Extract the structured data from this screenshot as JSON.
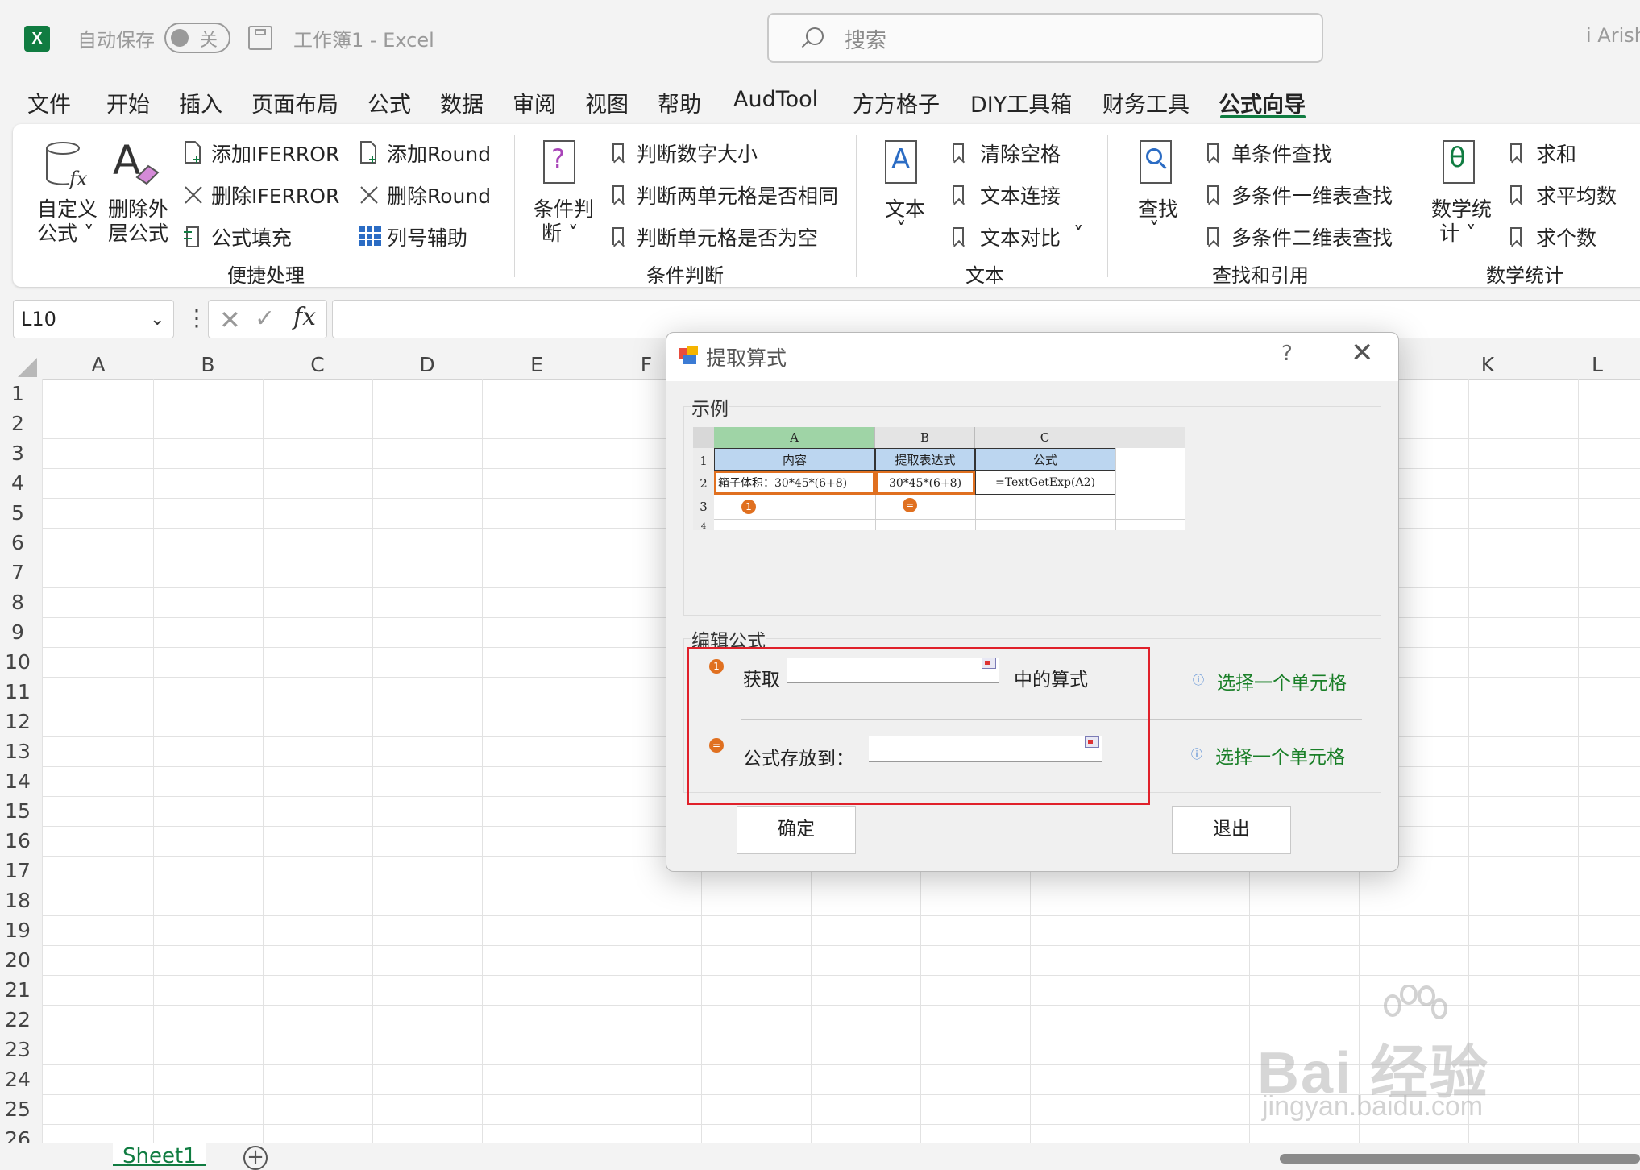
{
  "titlebar": {
    "app_icon_letter": "X",
    "autosave_label": "自动保存",
    "autosave_state": "关",
    "doc_title": "工作簿1  -  Excel",
    "search_placeholder": "搜索",
    "user_name": "i Arish"
  },
  "tabs": [
    "文件",
    "开始",
    "插入",
    "页面布局",
    "公式",
    "数据",
    "审阅",
    "视图",
    "帮助",
    "AudTool",
    "方方格子",
    "DIY工具箱",
    "财务工具",
    "公式向导"
  ],
  "active_tab": "公式向导",
  "ribbon": {
    "quick": {
      "custom_formula": [
        "自定义",
        "公式 ˅"
      ],
      "remove_outer": [
        "删除外",
        "层公式"
      ],
      "add_iferror": "添加IFERROR",
      "remove_iferror": "删除IFERROR",
      "formula_fill": "公式填充",
      "add_round": "添加Round",
      "remove_round": "删除Round",
      "col_helper": "列号辅助",
      "group": "便捷处理"
    },
    "condition": {
      "big": [
        "条件判",
        "断 ˅"
      ],
      "items": [
        "判断数字大小",
        "判断两单元格是否相同",
        "判断单元格是否为空"
      ],
      "group": "条件判断"
    },
    "text": {
      "big": [
        "文本",
        "˅"
      ],
      "items": [
        "清除空格",
        "文本连接",
        "文本对比"
      ],
      "more": "˅",
      "group": "文本"
    },
    "lookup": {
      "big": [
        "查找",
        "˅"
      ],
      "items": [
        "单条件查找",
        "多条件一维表查找",
        "多条件二维表查找"
      ],
      "group": "查找和引用"
    },
    "math": {
      "big": [
        "数学统",
        "计 ˅"
      ],
      "items": [
        "求和",
        "求平均数",
        "求个数"
      ],
      "group": "数学统计"
    }
  },
  "formula_bar": {
    "name_box": "L10",
    "cancel": "✕",
    "enter": "✓",
    "fx": "fx",
    "value": ""
  },
  "grid": {
    "columns": [
      "A",
      "B",
      "C",
      "D",
      "E",
      "F",
      "K",
      "L"
    ],
    "rows": [
      "1",
      "2",
      "3",
      "4",
      "5",
      "6",
      "7",
      "8",
      "9",
      "10",
      "11",
      "12",
      "13",
      "14",
      "15",
      "16",
      "17",
      "18",
      "19",
      "20",
      "21",
      "22",
      "23",
      "24",
      "25",
      "26"
    ]
  },
  "sheets": {
    "active": "Sheet1",
    "add": "+"
  },
  "dialog": {
    "title": "提取算式",
    "help": "?",
    "close": "✕",
    "example_label": "示例",
    "example": {
      "col_headers": [
        "A",
        "B",
        "C"
      ],
      "row_headers": [
        "1",
        "2",
        "3",
        "4"
      ],
      "header_row": [
        "内容",
        "提取表达式",
        "公式"
      ],
      "data_row": [
        "箱子体积：30*45*(6+8)",
        "30*45*(6+8)",
        "=TextGetExp(A2)"
      ],
      "markers": [
        "1",
        "="
      ]
    },
    "edit_label": "编辑公式",
    "row1": {
      "marker": "1",
      "prefix": "获取",
      "suffix": "中的算式",
      "value": "",
      "hint": "选择一个单元格"
    },
    "row2": {
      "marker": "=",
      "prefix": "公式存放到：",
      "value": "",
      "hint": "选择一个单元格"
    },
    "ok": "确定",
    "exit": "退出"
  },
  "watermark": {
    "brand": "Bai 经验",
    "url": "jingyan.baidu.com"
  },
  "colors": {
    "excel_green": "#107c41",
    "highlight_red": "#e0202a",
    "marker_orange": "#e07020",
    "hint_green": "#1a7f28"
  }
}
